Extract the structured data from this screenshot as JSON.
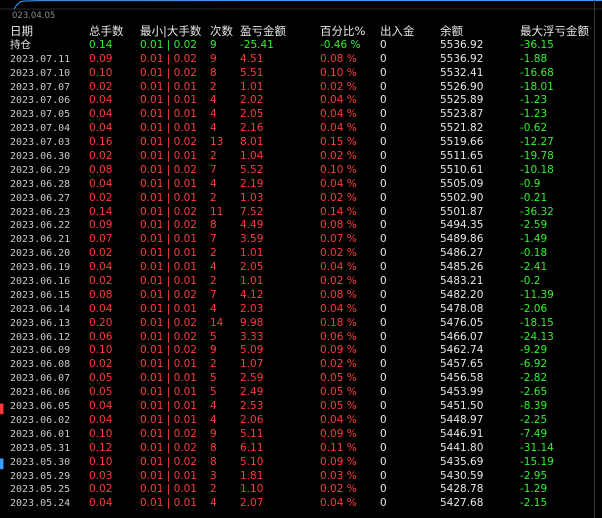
{
  "chart": {
    "axis_date": "023.04.05",
    "line_color": "#3aa0ff"
  },
  "columns": [
    "日期",
    "总手数",
    "最小|大手数",
    "次数",
    "盈亏金额",
    "百分比%",
    "出入金",
    "余额",
    "最大浮亏金额"
  ],
  "position": {
    "label": "持仓",
    "lots": "0.14",
    "minmax": "0.01 | 0.02",
    "count": "9",
    "pnl": "-25.41",
    "pct": "-0.46 %",
    "flow": "0",
    "balance": "5536.92",
    "maxdd": "-36.15"
  },
  "rows": [
    [
      "2023.07.11",
      "0.09",
      "0.01 | 0.02",
      "9",
      "4.51",
      "0.08 %",
      "0",
      "5536.92",
      "-1.88"
    ],
    [
      "2023.07.10",
      "0.10",
      "0.01 | 0.02",
      "8",
      "5.51",
      "0.10 %",
      "0",
      "5532.41",
      "-16.68"
    ],
    [
      "2023.07.07",
      "0.02",
      "0.01 | 0.01",
      "2",
      "1.01",
      "0.02 %",
      "0",
      "5526.90",
      "-18.01"
    ],
    [
      "2023.07.06",
      "0.04",
      "0.01 | 0.01",
      "4",
      "2.02",
      "0.04 %",
      "0",
      "5525.89",
      "-1.23"
    ],
    [
      "2023.07.05",
      "0.04",
      "0.01 | 0.01",
      "4",
      "2.05",
      "0.04 %",
      "0",
      "5523.87",
      "-1.23"
    ],
    [
      "2023.07.04",
      "0.04",
      "0.01 | 0.01",
      "4",
      "2.16",
      "0.04 %",
      "0",
      "5521.82",
      "-0.62"
    ],
    [
      "2023.07.03",
      "0.16",
      "0.01 | 0.02",
      "13",
      "8.01",
      "0.15 %",
      "0",
      "5519.66",
      "-12.27"
    ],
    [
      "2023.06.30",
      "0.02",
      "0.01 | 0.01",
      "2",
      "1.04",
      "0.02 %",
      "0",
      "5511.65",
      "-19.78"
    ],
    [
      "2023.06.29",
      "0.08",
      "0.01 | 0.02",
      "7",
      "5.52",
      "0.10 %",
      "0",
      "5510.61",
      "-10.18"
    ],
    [
      "2023.06.28",
      "0.04",
      "0.01 | 0.01",
      "4",
      "2.19",
      "0.04 %",
      "0",
      "5505.09",
      "-0.9"
    ],
    [
      "2023.06.27",
      "0.02",
      "0.01 | 0.01",
      "2",
      "1.03",
      "0.02 %",
      "0",
      "5502.90",
      "-0.21"
    ],
    [
      "2023.06.23",
      "0.14",
      "0.01 | 0.02",
      "11",
      "7.52",
      "0.14 %",
      "0",
      "5501.87",
      "-36.32"
    ],
    [
      "2023.06.22",
      "0.09",
      "0.01 | 0.02",
      "8",
      "4.49",
      "0.08 %",
      "0",
      "5494.35",
      "-2.59"
    ],
    [
      "2023.06.21",
      "0.07",
      "0.01 | 0.01",
      "7",
      "3.59",
      "0.07 %",
      "0",
      "5489.86",
      "-1.49"
    ],
    [
      "2023.06.20",
      "0.02",
      "0.01 | 0.01",
      "2",
      "1.01",
      "0.02 %",
      "0",
      "5486.27",
      "-0.18"
    ],
    [
      "2023.06.19",
      "0.04",
      "0.01 | 0.01",
      "4",
      "2.05",
      "0.04 %",
      "0",
      "5485.26",
      "-2.41"
    ],
    [
      "2023.06.16",
      "0.02",
      "0.01 | 0.01",
      "2",
      "1.01",
      "0.02 %",
      "0",
      "5483.21",
      "-0.2"
    ],
    [
      "2023.06.15",
      "0.08",
      "0.01 | 0.02",
      "7",
      "4.12",
      "0.08 %",
      "0",
      "5482.20",
      "-11.39"
    ],
    [
      "2023.06.14",
      "0.04",
      "0.01 | 0.01",
      "4",
      "2.03",
      "0.04 %",
      "0",
      "5478.08",
      "-2.06"
    ],
    [
      "2023.06.13",
      "0.20",
      "0.01 | 0.02",
      "14",
      "9.98",
      "0.18 %",
      "0",
      "5476.05",
      "-18.15"
    ],
    [
      "2023.06.12",
      "0.06",
      "0.01 | 0.02",
      "5",
      "3.33",
      "0.06 %",
      "0",
      "5466.07",
      "-24.13"
    ],
    [
      "2023.06.09",
      "0.10",
      "0.01 | 0.02",
      "9",
      "5.09",
      "0.09 %",
      "0",
      "5462.74",
      "-9.29"
    ],
    [
      "2023.06.08",
      "0.02",
      "0.01 | 0.01",
      "2",
      "1.07",
      "0.02 %",
      "0",
      "5457.65",
      "-6.92"
    ],
    [
      "2023.06.07",
      "0.05",
      "0.01 | 0.01",
      "5",
      "2.59",
      "0.05 %",
      "0",
      "5456.58",
      "-2.82"
    ],
    [
      "2023.06.06",
      "0.05",
      "0.01 | 0.01",
      "5",
      "2.49",
      "0.05 %",
      "0",
      "5453.99",
      "-2.65"
    ],
    [
      "2023.06.05",
      "0.04",
      "0.01 | 0.01",
      "4",
      "2.53",
      "0.05 %",
      "0",
      "5451.50",
      "-8.39"
    ],
    [
      "2023.06.02",
      "0.04",
      "0.01 | 0.01",
      "4",
      "2.06",
      "0.04 %",
      "0",
      "5448.97",
      "-2.25"
    ],
    [
      "2023.06.01",
      "0.10",
      "0.01 | 0.02",
      "9",
      "5.11",
      "0.09 %",
      "0",
      "5446.91",
      "-7.49"
    ],
    [
      "2023.05.31",
      "0.12",
      "0.01 | 0.02",
      "8",
      "6.11",
      "0.11 %",
      "0",
      "5441.80",
      "-31.14"
    ],
    [
      "2023.05.30",
      "0.10",
      "0.01 | 0.02",
      "8",
      "5.10",
      "0.09 %",
      "0",
      "5435.69",
      "-15.19"
    ],
    [
      "2023.05.29",
      "0.03",
      "0.01 | 0.01",
      "3",
      "1.81",
      "0.03 %",
      "0",
      "5430.59",
      "-2.95"
    ],
    [
      "2023.05.25",
      "0.02",
      "0.01 | 0.01",
      "2",
      "1.10",
      "0.02 %",
      "0",
      "5428.78",
      "-1.29"
    ],
    [
      "2023.05.24",
      "0.04",
      "0.01 | 0.01",
      "4",
      "2.07",
      "0.04 %",
      "0",
      "5427.68",
      "-2.15"
    ]
  ]
}
